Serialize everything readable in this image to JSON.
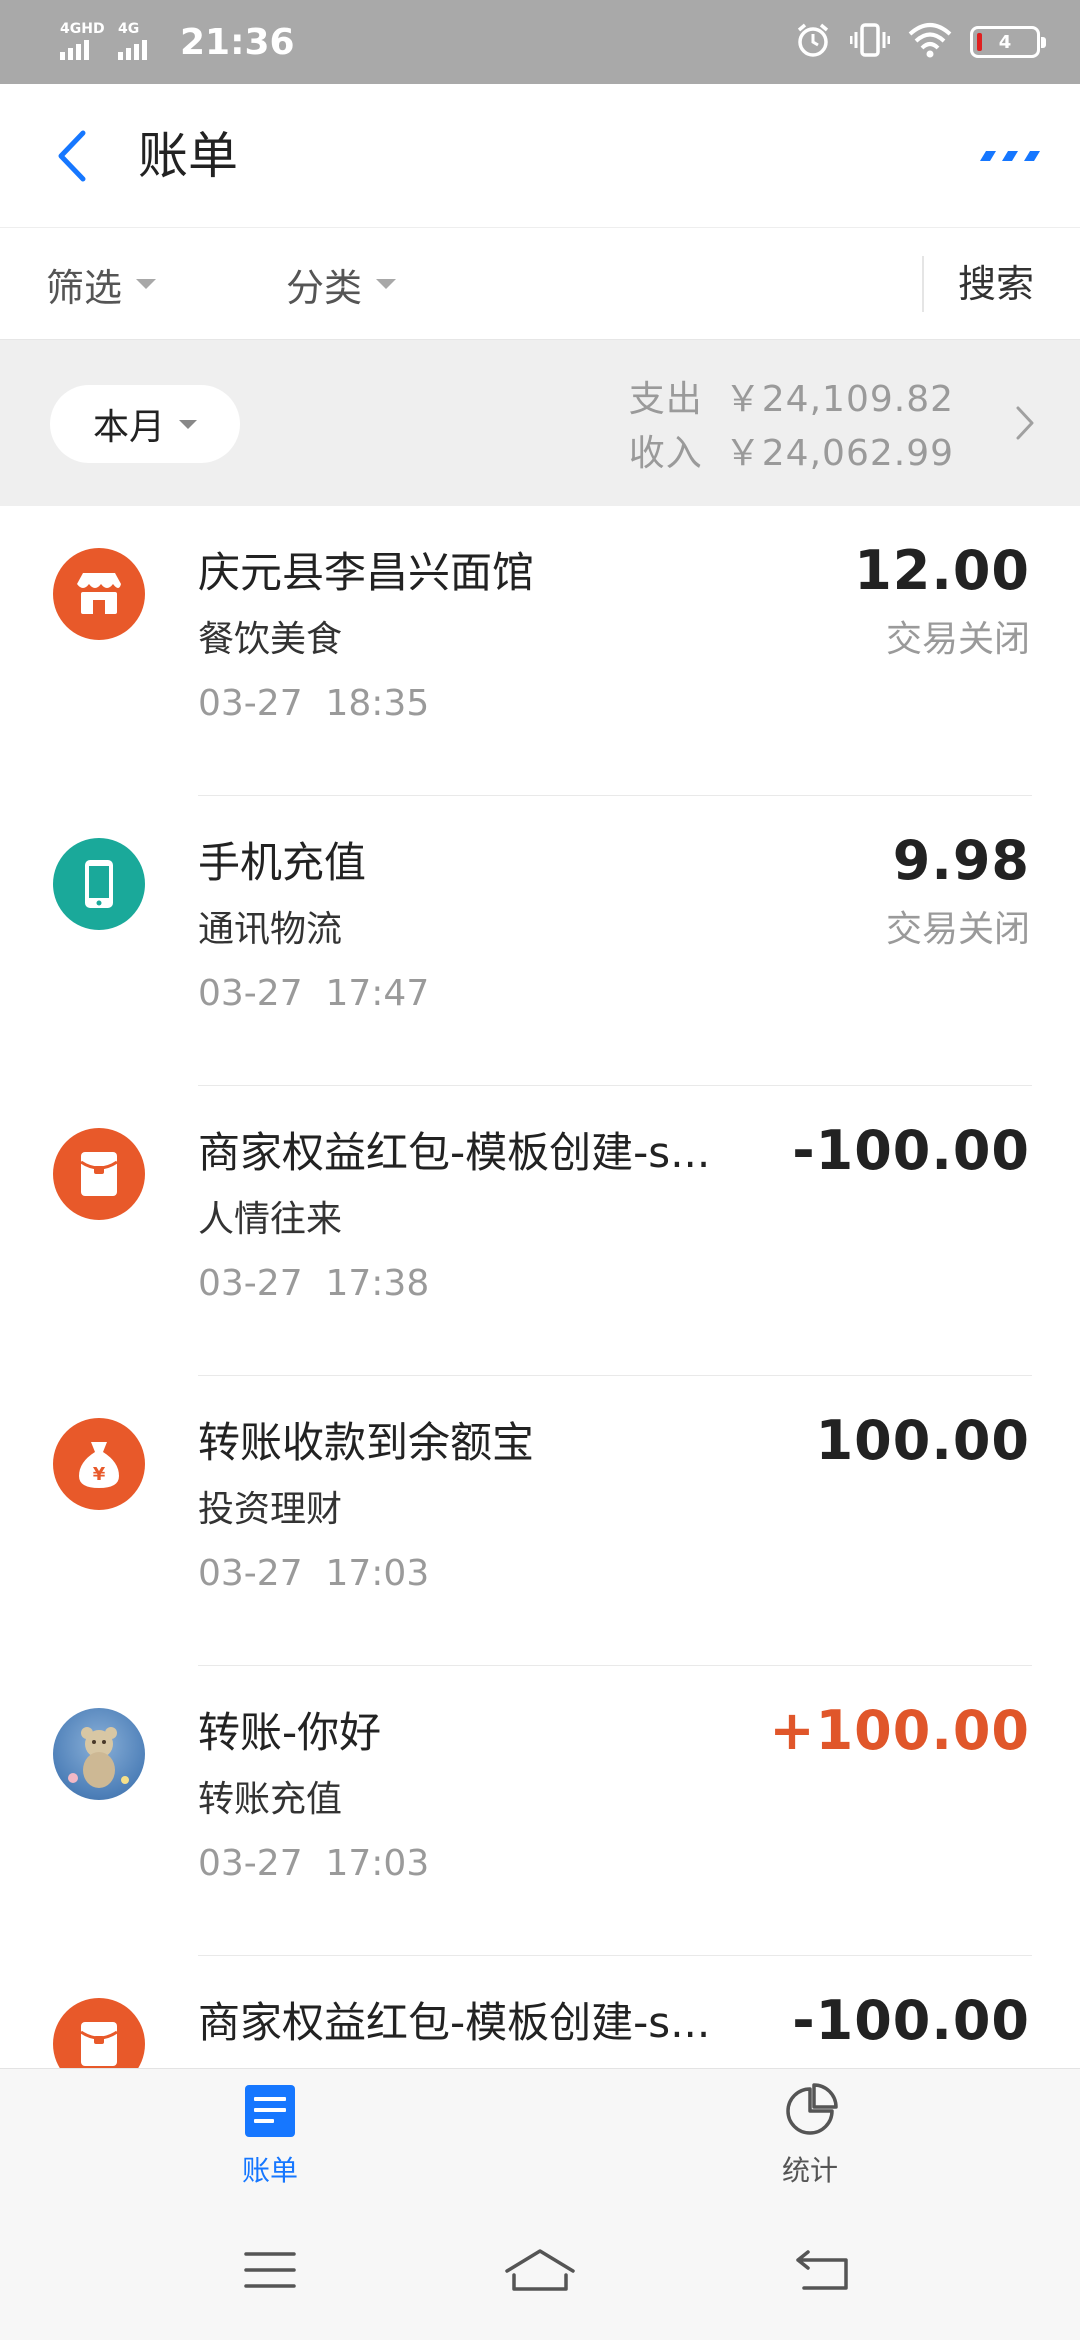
{
  "status_bar": {
    "signals": [
      {
        "network": "4GHD"
      },
      {
        "network": "4G"
      }
    ],
    "time": "21:36",
    "icons": [
      "alarm-icon",
      "vibrate-icon",
      "wifi-icon",
      "battery-icon"
    ],
    "battery_level": "4"
  },
  "header": {
    "title": "账单",
    "back_icon": "back-arrow-icon",
    "more_icon": "more-dots-icon"
  },
  "filters": {
    "filter_label": "筛选",
    "category_label": "分类",
    "search_label": "搜索"
  },
  "summary": {
    "period": "本月",
    "expense_label": "支出",
    "expense_value": "￥24,109.82",
    "income_label": "收入",
    "income_value": "￥24,062.99"
  },
  "transactions": [
    {
      "title": "庆元县李昌兴面馆",
      "category": "餐饮美食",
      "time": "03-27  18:35",
      "amount": "12.00",
      "status": "交易关闭",
      "icon": "store-icon"
    },
    {
      "title": "手机充值",
      "category": "通讯物流",
      "time": "03-27  17:47",
      "amount": "9.98",
      "status": "交易关闭",
      "icon": "phone-icon"
    },
    {
      "title": "商家权益红包-模板创建-s...",
      "category": "人情往来",
      "time": "03-27  17:38",
      "amount": "-100.00",
      "status": "",
      "icon": "red-envelope-icon"
    },
    {
      "title": "转账收款到余额宝",
      "category": "投资理财",
      "time": "03-27  17:03",
      "amount": "100.00",
      "status": "",
      "icon": "money-bag-icon"
    },
    {
      "title": "转账-你好",
      "category": "转账充值",
      "time": "03-27  17:03",
      "amount": "+100.00",
      "status": "",
      "icon": "user-avatar-icon"
    },
    {
      "title": "商家权益红包-模板创建-s...",
      "category": "",
      "time": "",
      "amount": "-100.00",
      "status": "",
      "icon": "red-envelope-icon"
    }
  ],
  "tabs": {
    "bills": {
      "label": "账单",
      "icon": "bill-list-icon",
      "active": true
    },
    "stats": {
      "label": "统计",
      "icon": "pie-chart-icon",
      "active": false
    }
  },
  "nav": {
    "menu_icon": "menu-icon",
    "home_icon": "home-icon",
    "back_icon": "return-icon"
  },
  "colors": {
    "accent": "#1677ff",
    "expense_icon": "#e8592a",
    "telecom_icon": "#1aa99a",
    "income_amount": "#e0562a",
    "summary_bg": "#efefef"
  }
}
